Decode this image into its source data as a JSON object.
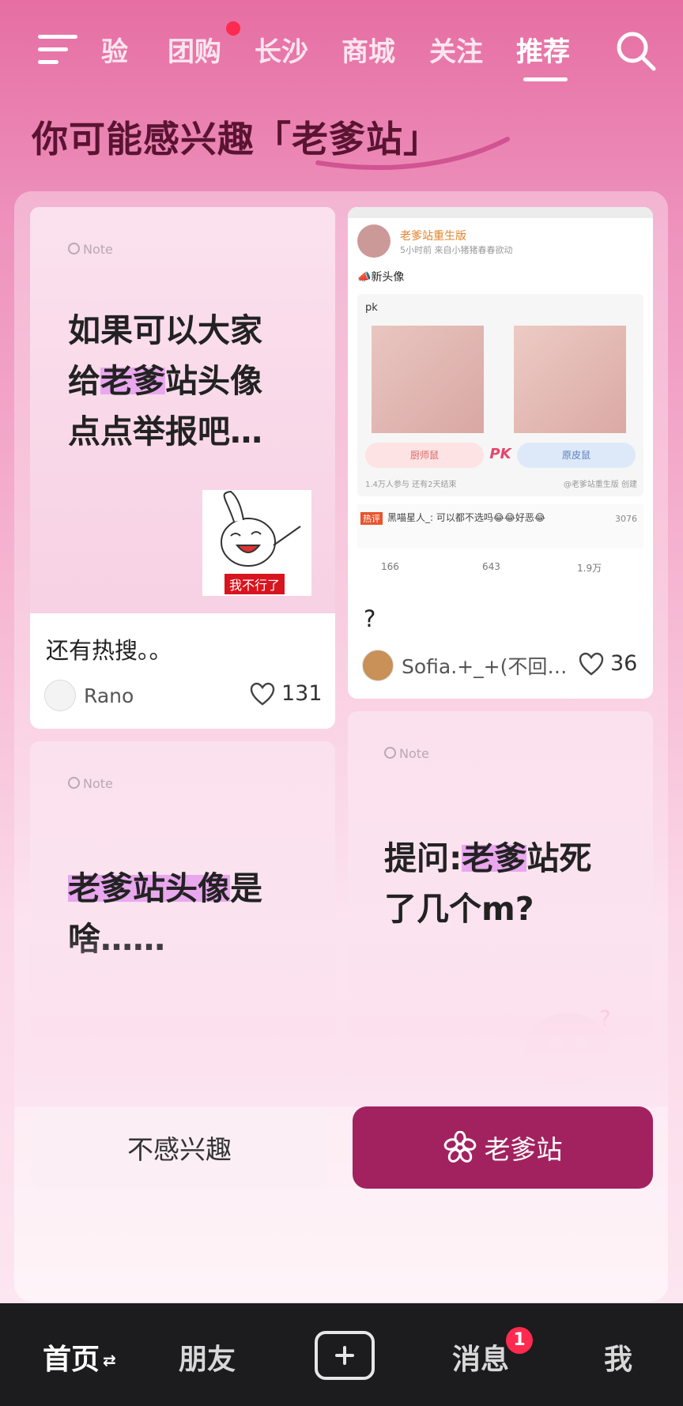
{
  "nav": {
    "tabs": [
      {
        "label": "验"
      },
      {
        "label": "团购"
      },
      {
        "label": "长沙"
      },
      {
        "label": "商城"
      },
      {
        "label": "关注"
      },
      {
        "label": "推荐"
      }
    ],
    "active_tab": "推荐"
  },
  "heading": "你可能感兴趣「老爹站」",
  "cards": [
    {
      "note_tag": "Note",
      "note_lines": [
        "如果可以大家",
        "给",
        "老爹",
        "站头像",
        "点点举报吧…"
      ],
      "sticker_caption": "我不行了",
      "title": "还有热搜。。",
      "author": "Rano",
      "likes": "131"
    },
    {
      "shot": {
        "account": "老爹站重生版",
        "meta": "5小时前  来自小猪猪春春欲动",
        "post_text": "📣新头像",
        "vote_label": "pk",
        "option_left": "厨师鼠",
        "pk": "PK",
        "option_right": "原皮鼠",
        "vote_stats": "1.4万人参与  还有2天结束",
        "vote_creator": "@老爹站重生版 创建",
        "hot_tag": "热评",
        "hot_comment": "黑喵星人_: 可以都不选吗😂😂好恶😂",
        "hot_likes": "3076",
        "reposts": "166",
        "comments": "643",
        "likes": "1.9万"
      },
      "title": "?",
      "author": "Sofia.+_+(不回…",
      "likes": "36"
    },
    {
      "note_tag": "Note",
      "note_hl": "老爹站头像",
      "note_rest1": "是",
      "note_line2": "啥……"
    },
    {
      "note_tag": "Note",
      "note_pre": "提问:",
      "note_hl": "老爹",
      "note_rest1": "站死",
      "note_line2": "了几个m?"
    }
  ],
  "buttons": {
    "not_interested": "不感兴趣",
    "topic": "老爹站"
  },
  "bottom_nav": {
    "home": "首页",
    "friends": "朋友",
    "messages": "消息",
    "messages_badge": "1",
    "me": "我"
  },
  "colors": {
    "accent": "#a2225f",
    "badge": "#ff2a4f",
    "highlight": "#e9a7ee"
  }
}
